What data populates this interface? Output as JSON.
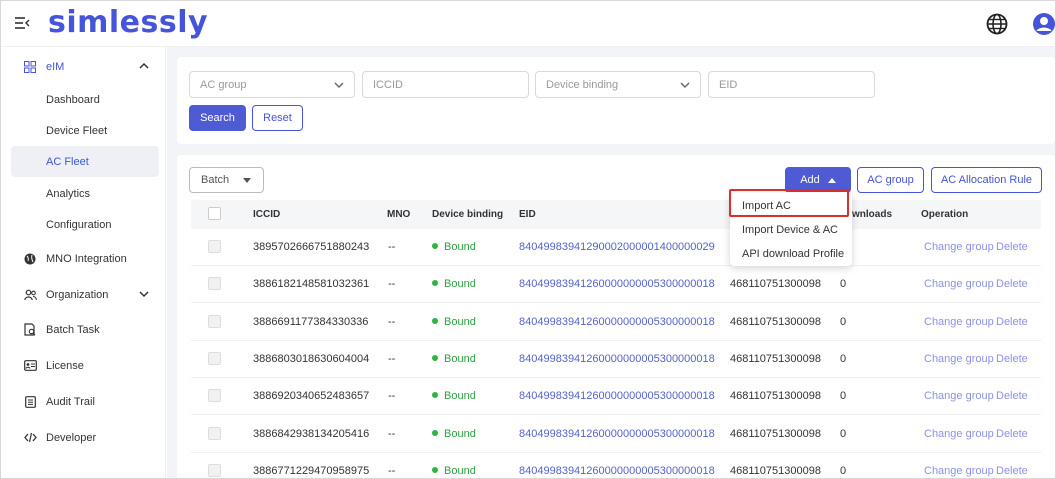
{
  "header": {
    "logo": "simlessly",
    "menu_icon": "menu-collapse-icon",
    "globe_icon": "globe-icon",
    "user_icon": "user-icon"
  },
  "sidebar": {
    "items": [
      {
        "label": "eIM",
        "icon": "grid-icon",
        "expanded": true
      },
      {
        "label": "Dashboard"
      },
      {
        "label": "Device Fleet"
      },
      {
        "label": "AC Fleet",
        "active": true
      },
      {
        "label": "Analytics"
      },
      {
        "label": "Configuration"
      },
      {
        "label": "MNO Integration",
        "icon": "globe-icon"
      },
      {
        "label": "Organization",
        "icon": "people-icon",
        "expanded": false
      },
      {
        "label": "Batch Task",
        "icon": "task-icon"
      },
      {
        "label": "License",
        "icon": "license-icon"
      },
      {
        "label": "Audit Trail",
        "icon": "list-icon"
      },
      {
        "label": "Developer",
        "icon": "code-icon"
      }
    ]
  },
  "filters": {
    "ac_group_placeholder": "AC group",
    "iccid_placeholder": "ICCID",
    "device_binding_placeholder": "Device binding",
    "eid_placeholder": "EID",
    "search_label": "Search",
    "reset_label": "Reset"
  },
  "toolbar": {
    "batch_label": "Batch",
    "add_label": "Add",
    "ac_group_label": "AC group",
    "allocation_rule_label": "AC Allocation Rule"
  },
  "add_menu": {
    "items": [
      "Import AC",
      "Import Device & AC",
      "API download Profile"
    ],
    "highlighted": "Import AC"
  },
  "table": {
    "columns": [
      "ICCID",
      "MNO",
      "Device binding",
      "EID",
      "wnloads",
      "Operation"
    ],
    "rows": [
      {
        "iccid": "3895702666751880243",
        "mno": "--",
        "binding": "Bound",
        "eid": "84049983941290002000001400000029",
        "col5": "",
        "downloads": "",
        "op1": "Change group",
        "op2": "Delete"
      },
      {
        "iccid": "3886182148581032361",
        "mno": "--",
        "binding": "Bound",
        "eid": "84049983941260000000005300000018",
        "col5": "468110751300098",
        "downloads": "0",
        "op1": "Change group",
        "op2": "Delete"
      },
      {
        "iccid": "3886691177384330336",
        "mno": "--",
        "binding": "Bound",
        "eid": "84049983941260000000005300000018",
        "col5": "468110751300098",
        "downloads": "0",
        "op1": "Change group",
        "op2": "Delete"
      },
      {
        "iccid": "3886803018630604004",
        "mno": "--",
        "binding": "Bound",
        "eid": "84049983941260000000005300000018",
        "col5": "468110751300098",
        "downloads": "0",
        "op1": "Change group",
        "op2": "Delete"
      },
      {
        "iccid": "3886920340652483657",
        "mno": "--",
        "binding": "Bound",
        "eid": "84049983941260000000005300000018",
        "col5": "468110751300098",
        "downloads": "0",
        "op1": "Change group",
        "op2": "Delete"
      },
      {
        "iccid": "3886842938134205416",
        "mno": "--",
        "binding": "Bound",
        "eid": "84049983941260000000005300000018",
        "col5": "468110751300098",
        "downloads": "0",
        "op1": "Change group",
        "op2": "Delete"
      },
      {
        "iccid": "3886771229470958975",
        "mno": "--",
        "binding": "Bound",
        "eid": "84049983941260000000005300000018",
        "col5": "468110751300098",
        "downloads": "0",
        "op1": "Change group",
        "op2": "Delete"
      }
    ]
  },
  "colors": {
    "primary": "#4f5bd5",
    "bound": "#2fb344",
    "highlight_box": "#d9302c",
    "active_bg": "#eef0f6"
  }
}
